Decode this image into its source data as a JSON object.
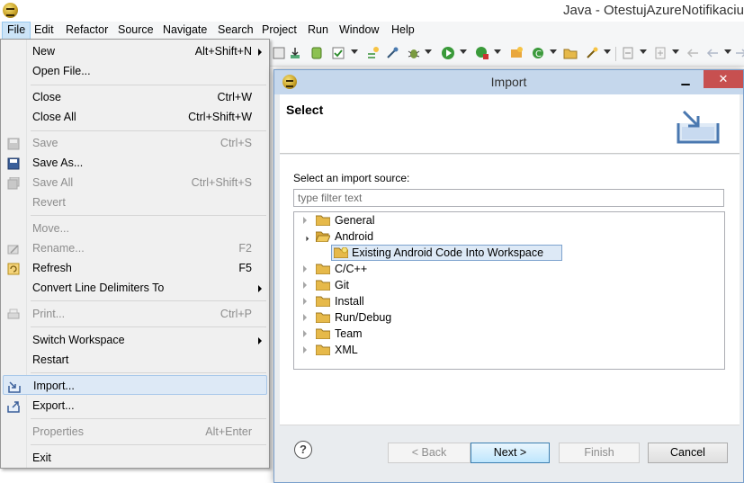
{
  "window": {
    "title": "Java - OtestujAzureNotifikaciu"
  },
  "menubar": [
    "File",
    "Edit",
    "Refactor",
    "Source",
    "Navigate",
    "Search",
    "Project",
    "Run",
    "Window",
    "Help"
  ],
  "file_menu": {
    "items": [
      {
        "label": "New",
        "accel": "Alt+Shift+N"
      },
      {
        "label": "Open File...",
        "accel": ""
      },
      {
        "label": "Close",
        "accel": "Ctrl+W"
      },
      {
        "label": "Close All",
        "accel": "Ctrl+Shift+W"
      },
      {
        "label": "Save",
        "accel": "Ctrl+S"
      },
      {
        "label": "Save As...",
        "accel": ""
      },
      {
        "label": "Save All",
        "accel": "Ctrl+Shift+S"
      },
      {
        "label": "Revert",
        "accel": ""
      },
      {
        "label": "Move...",
        "accel": ""
      },
      {
        "label": "Rename...",
        "accel": "F2"
      },
      {
        "label": "Refresh",
        "accel": "F5"
      },
      {
        "label": "Convert Line Delimiters To",
        "accel": ""
      },
      {
        "label": "Print...",
        "accel": "Ctrl+P"
      },
      {
        "label": "Switch Workspace",
        "accel": ""
      },
      {
        "label": "Restart",
        "accel": ""
      },
      {
        "label": "Import...",
        "accel": ""
      },
      {
        "label": "Export...",
        "accel": ""
      },
      {
        "label": "Properties",
        "accel": "Alt+Enter"
      },
      {
        "label": "Exit",
        "accel": ""
      }
    ]
  },
  "dialog": {
    "title": "Import",
    "heading": "Select",
    "source_label": "Select an import source:",
    "filter_placeholder": "type filter text",
    "tree": [
      {
        "label": "General",
        "expanded": false
      },
      {
        "label": "Android",
        "expanded": true
      },
      {
        "label": "Existing Android Code Into Workspace",
        "selected": true
      },
      {
        "label": "C/C++",
        "expanded": false
      },
      {
        "label": "Git",
        "expanded": false
      },
      {
        "label": "Install",
        "expanded": false
      },
      {
        "label": "Run/Debug",
        "expanded": false
      },
      {
        "label": "Team",
        "expanded": false
      },
      {
        "label": "XML",
        "expanded": false
      }
    ],
    "buttons": {
      "help": "?",
      "back": "< Back",
      "next": "Next >",
      "finish": "Finish",
      "cancel": "Cancel"
    },
    "window_controls": {
      "minimize": "▁",
      "maximize": "□",
      "close": "✕"
    }
  },
  "colors": {
    "selection": "#dde9f6",
    "dialog_title": "#c5d7ec",
    "close_button": "#c75050"
  }
}
